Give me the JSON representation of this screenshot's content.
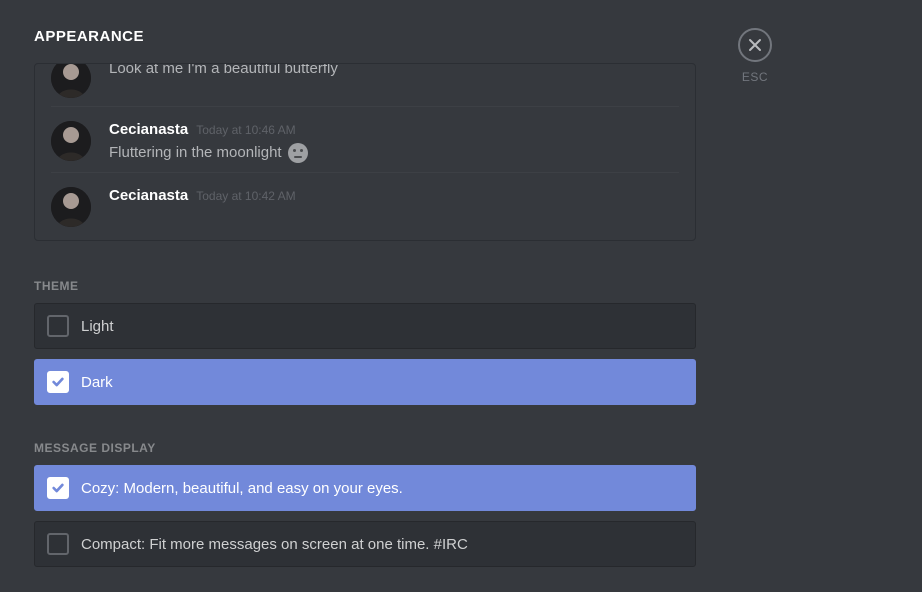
{
  "title": "APPEARANCE",
  "close": {
    "label": "ESC"
  },
  "preview": {
    "messages": [
      {
        "username": "",
        "timestamp": "",
        "text": "Look at me I'm a beautiful butterfly",
        "partial": true
      },
      {
        "username": "Cecianasta",
        "timestamp": "Today at 10:46 AM",
        "text": "Fluttering in the moonlight",
        "emoji": true
      },
      {
        "username": "Cecianasta",
        "timestamp": "Today at 10:42 AM",
        "text": ""
      }
    ]
  },
  "sections": {
    "theme": {
      "label": "THEME",
      "options": {
        "light": {
          "label": "Light",
          "selected": false
        },
        "dark": {
          "label": "Dark",
          "selected": true
        }
      }
    },
    "message_display": {
      "label": "MESSAGE DISPLAY",
      "options": {
        "cozy": {
          "label": "Cozy: Modern, beautiful, and easy on your eyes.",
          "selected": true
        },
        "compact": {
          "label": "Compact: Fit more messages on screen at one time. #IRC",
          "selected": false
        }
      }
    }
  }
}
